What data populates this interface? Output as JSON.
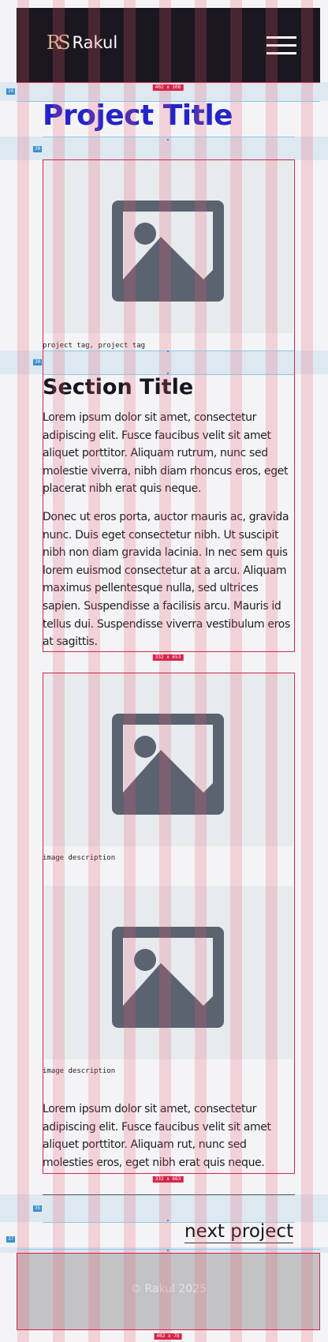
{
  "header": {
    "brand_mark": "RS",
    "brand_name": "Rakul",
    "menu_icon": "hamburger-menu-icon"
  },
  "page_title": "Project Title",
  "hero_image": {
    "icon": "image-placeholder-icon"
  },
  "tags": "project tag, project tag",
  "section": {
    "title": "Section Title",
    "paragraphs": [
      "Lorem ipsum dolor sit amet, consectetur adipiscing elit. Fusce faucibus velit sit amet aliquet porttitor. Aliquam rutrum, nunc sed molestie viverra, nibh diam rhoncus eros, eget placerat nibh erat quis neque.",
      "Donec ut eros porta, auctor mauris ac, gravida nunc. Duis eget consectetur nibh. Ut suscipit nibh non diam gravida lacinia. In nec sem quis lorem euismod consectetur at a arcu. Aliquam maximus pellentesque nulla, sed ultrices sapien. Suspendisse a facilisis arcu. Mauris id tellus dui. Suspendisse viverra vestibulum eros at sagittis."
    ]
  },
  "gallery": [
    {
      "caption": "image description",
      "icon": "image-placeholder-icon"
    },
    {
      "caption": "image description",
      "icon": "image-placeholder-icon"
    }
  ],
  "closing_paragraph": "Lorem ipsum dolor sit amet, consectetur adipiscing elit. Fusce faucibus velit sit amet aliquet porttitor. Aliquam rut, nunc sed molesties eros, eget nibh erat quis neque.",
  "next_project": "next project",
  "footer": {
    "copyright": "© Rakul 2025"
  },
  "overlay": {
    "spacers": [
      "24",
      "30",
      "30",
      "35",
      "37"
    ],
    "dimensions": [
      "402 x 108",
      "332 x 653",
      "332 x 663",
      "402 x 78"
    ]
  },
  "colors": {
    "header_bg": "#1b1720",
    "title": "#2424c8",
    "brand_accent": "#e0bd98",
    "placeholder_bg": "#e8ebee",
    "placeholder_icon": "#5b6270",
    "footer_bg": "#c3c3c6",
    "overlay_red": "#d6264a",
    "overlay_blue": "#3a8fd0"
  }
}
